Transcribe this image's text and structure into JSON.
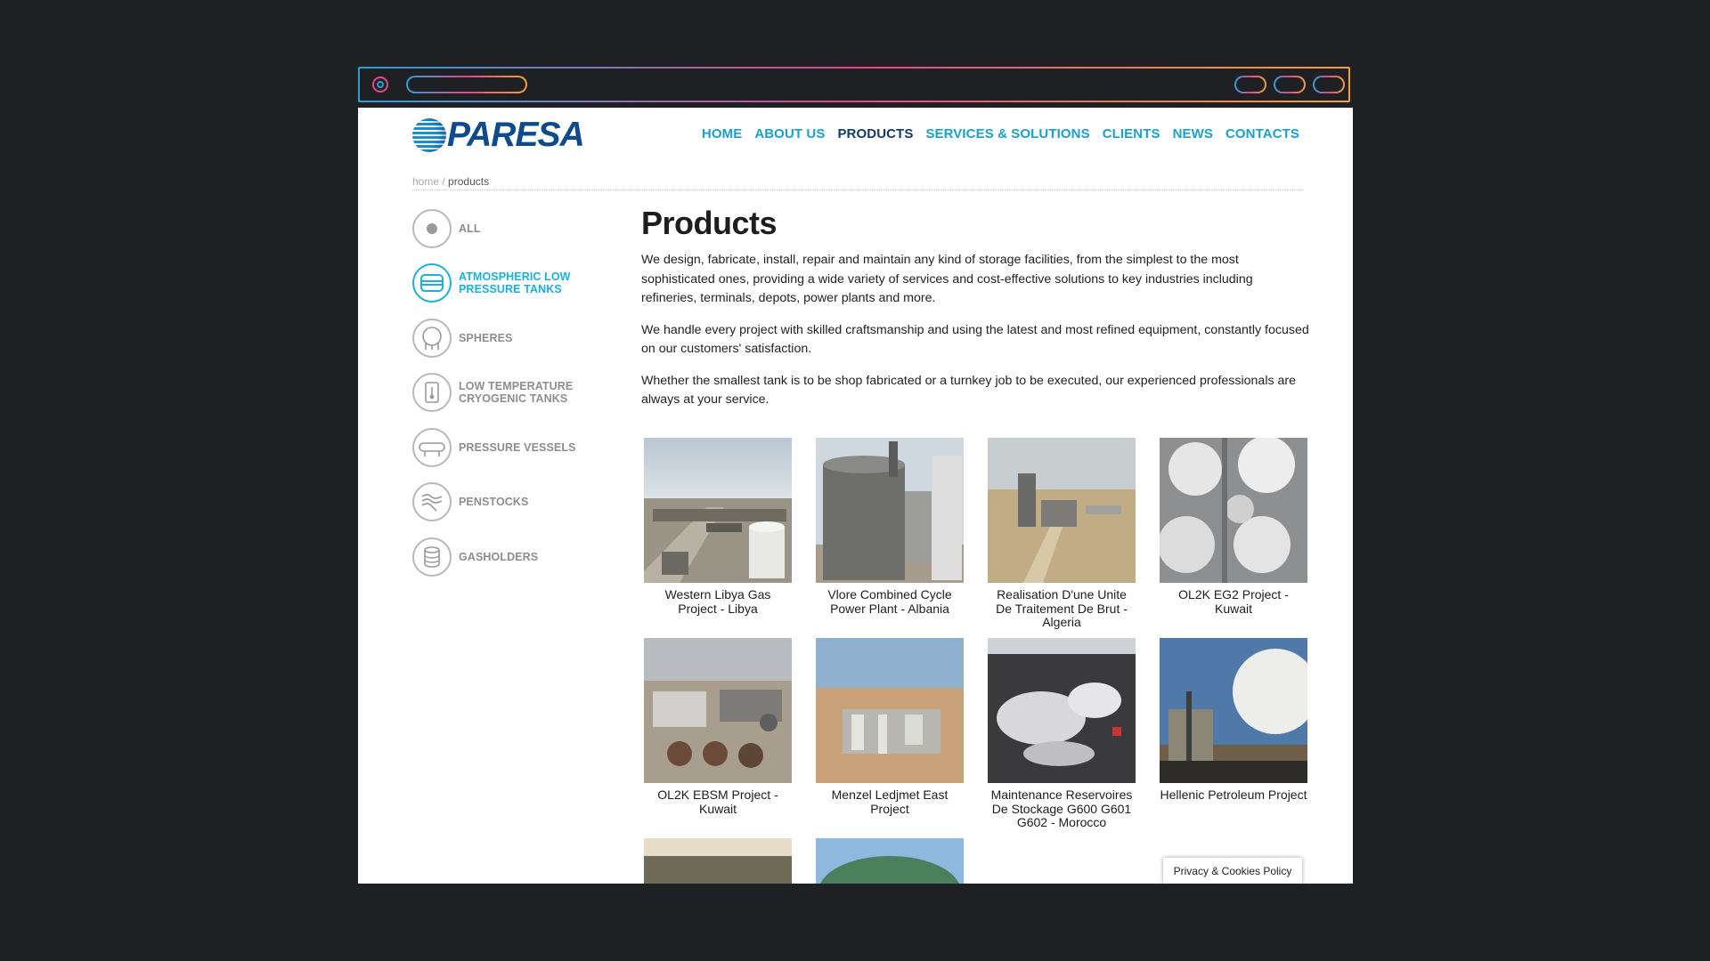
{
  "logo": {
    "text": "PARESA"
  },
  "nav": [
    "HOME",
    "ABOUT US",
    "PRODUCTS",
    "SERVICES & SOLUTIONS",
    "CLIENTS",
    "NEWS",
    "CONTACTS"
  ],
  "breadcrumb": {
    "home": "home",
    "sep": " / ",
    "current": "products"
  },
  "categories": [
    {
      "label": "ALL",
      "icon": "dot-icon"
    },
    {
      "label": "ATMOSPHERIC LOW\nPRESSURE TANKS",
      "icon": "tank-icon"
    },
    {
      "label": "SPHERES",
      "icon": "sphere-icon"
    },
    {
      "label": "LOW TEMPERATURE\nCRYOGENIC TANKS",
      "icon": "thermometer-tank-icon"
    },
    {
      "label": "PRESSURE VESSELS",
      "icon": "vessel-icon"
    },
    {
      "label": "PENSTOCKS",
      "icon": "penstock-icon"
    },
    {
      "label": "GASHOLDERS",
      "icon": "gasholder-icon"
    }
  ],
  "main": {
    "title": "Products",
    "paragraphs": [
      "We design, fabricate, install, repair and maintain any kind of storage facilities, from the simplest to the most sophisticated ones, providing a wide variety of services and cost-effective solutions to key industries including refineries, terminals, depots, power plants and more.",
      "We handle every project with skilled craftsmanship and using the latest and most refined equipment, constantly focused on our customers' satisfaction.",
      "Whether the smallest tank is to be shop fabricated or a turnkey job to be executed, our experienced professionals are always at your service."
    ]
  },
  "projects": [
    {
      "caption": "Western Libya Gas Project - Libya"
    },
    {
      "caption": "Vlore Combined Cycle Power Plant - Albania"
    },
    {
      "caption": "Realisation D'une Unite De Traitement De Brut - Algeria"
    },
    {
      "caption": "OL2K EG2 Project - Kuwait"
    },
    {
      "caption": "OL2K EBSM Project - Kuwait"
    },
    {
      "caption": "Menzel Ledjmet East Project"
    },
    {
      "caption": "Maintenance Reservoires De Stockage G600 G601 G602 - Morocco"
    },
    {
      "caption": "Hellenic Petroleum Project"
    },
    {
      "caption": ""
    },
    {
      "caption": ""
    }
  ],
  "cookie": {
    "label": "Privacy & Cookies Policy"
  },
  "colors": {
    "accent": "#1aa0cf",
    "active_nav": "#123a6b",
    "brand": "#0d4b8c"
  }
}
